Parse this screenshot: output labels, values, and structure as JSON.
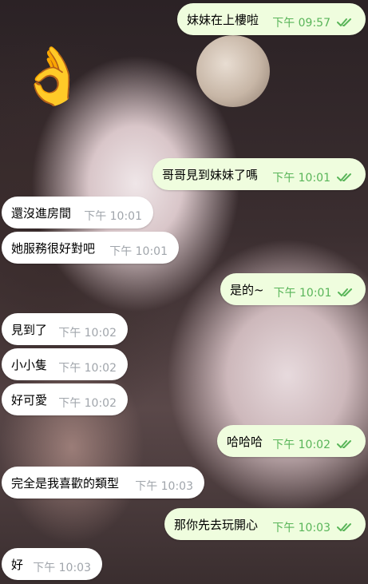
{
  "colors": {
    "outgoing_bubble": "#effdde",
    "incoming_bubble": "#ffffff",
    "outgoing_time": "#59b559",
    "incoming_time": "#a0a5ab",
    "read_ticks": "#59b559"
  },
  "background": {
    "description_icon": "ok-hand-emoji",
    "emoji": "👌"
  },
  "messages": [
    {
      "direction": "out",
      "text": "妹妹在上樓啦",
      "time": "下午 09:57",
      "read": true
    },
    {
      "direction": "out",
      "text": "哥哥見到妹妹了嗎",
      "time": "下午 10:01",
      "read": true
    },
    {
      "direction": "in",
      "text": "還沒進房間",
      "time": "下午 10:01"
    },
    {
      "direction": "in",
      "text": "她服務很好對吧",
      "time": "下午 10:01"
    },
    {
      "direction": "out",
      "text": "是的~",
      "time": "下午 10:01",
      "read": true
    },
    {
      "direction": "in",
      "text": "見到了",
      "time": "下午 10:02"
    },
    {
      "direction": "in",
      "text": "小小隻",
      "time": "下午 10:02"
    },
    {
      "direction": "in",
      "text": "好可愛",
      "time": "下午 10:02"
    },
    {
      "direction": "out",
      "text": "哈哈哈",
      "time": "下午 10:02",
      "read": true
    },
    {
      "direction": "in",
      "text": "完全是我喜歡的類型",
      "time": "下午 10:03"
    },
    {
      "direction": "out",
      "text": "那你先去玩開心",
      "time": "下午 10:03",
      "read": true
    },
    {
      "direction": "in",
      "text": "好",
      "time": "下午 10:03"
    }
  ]
}
